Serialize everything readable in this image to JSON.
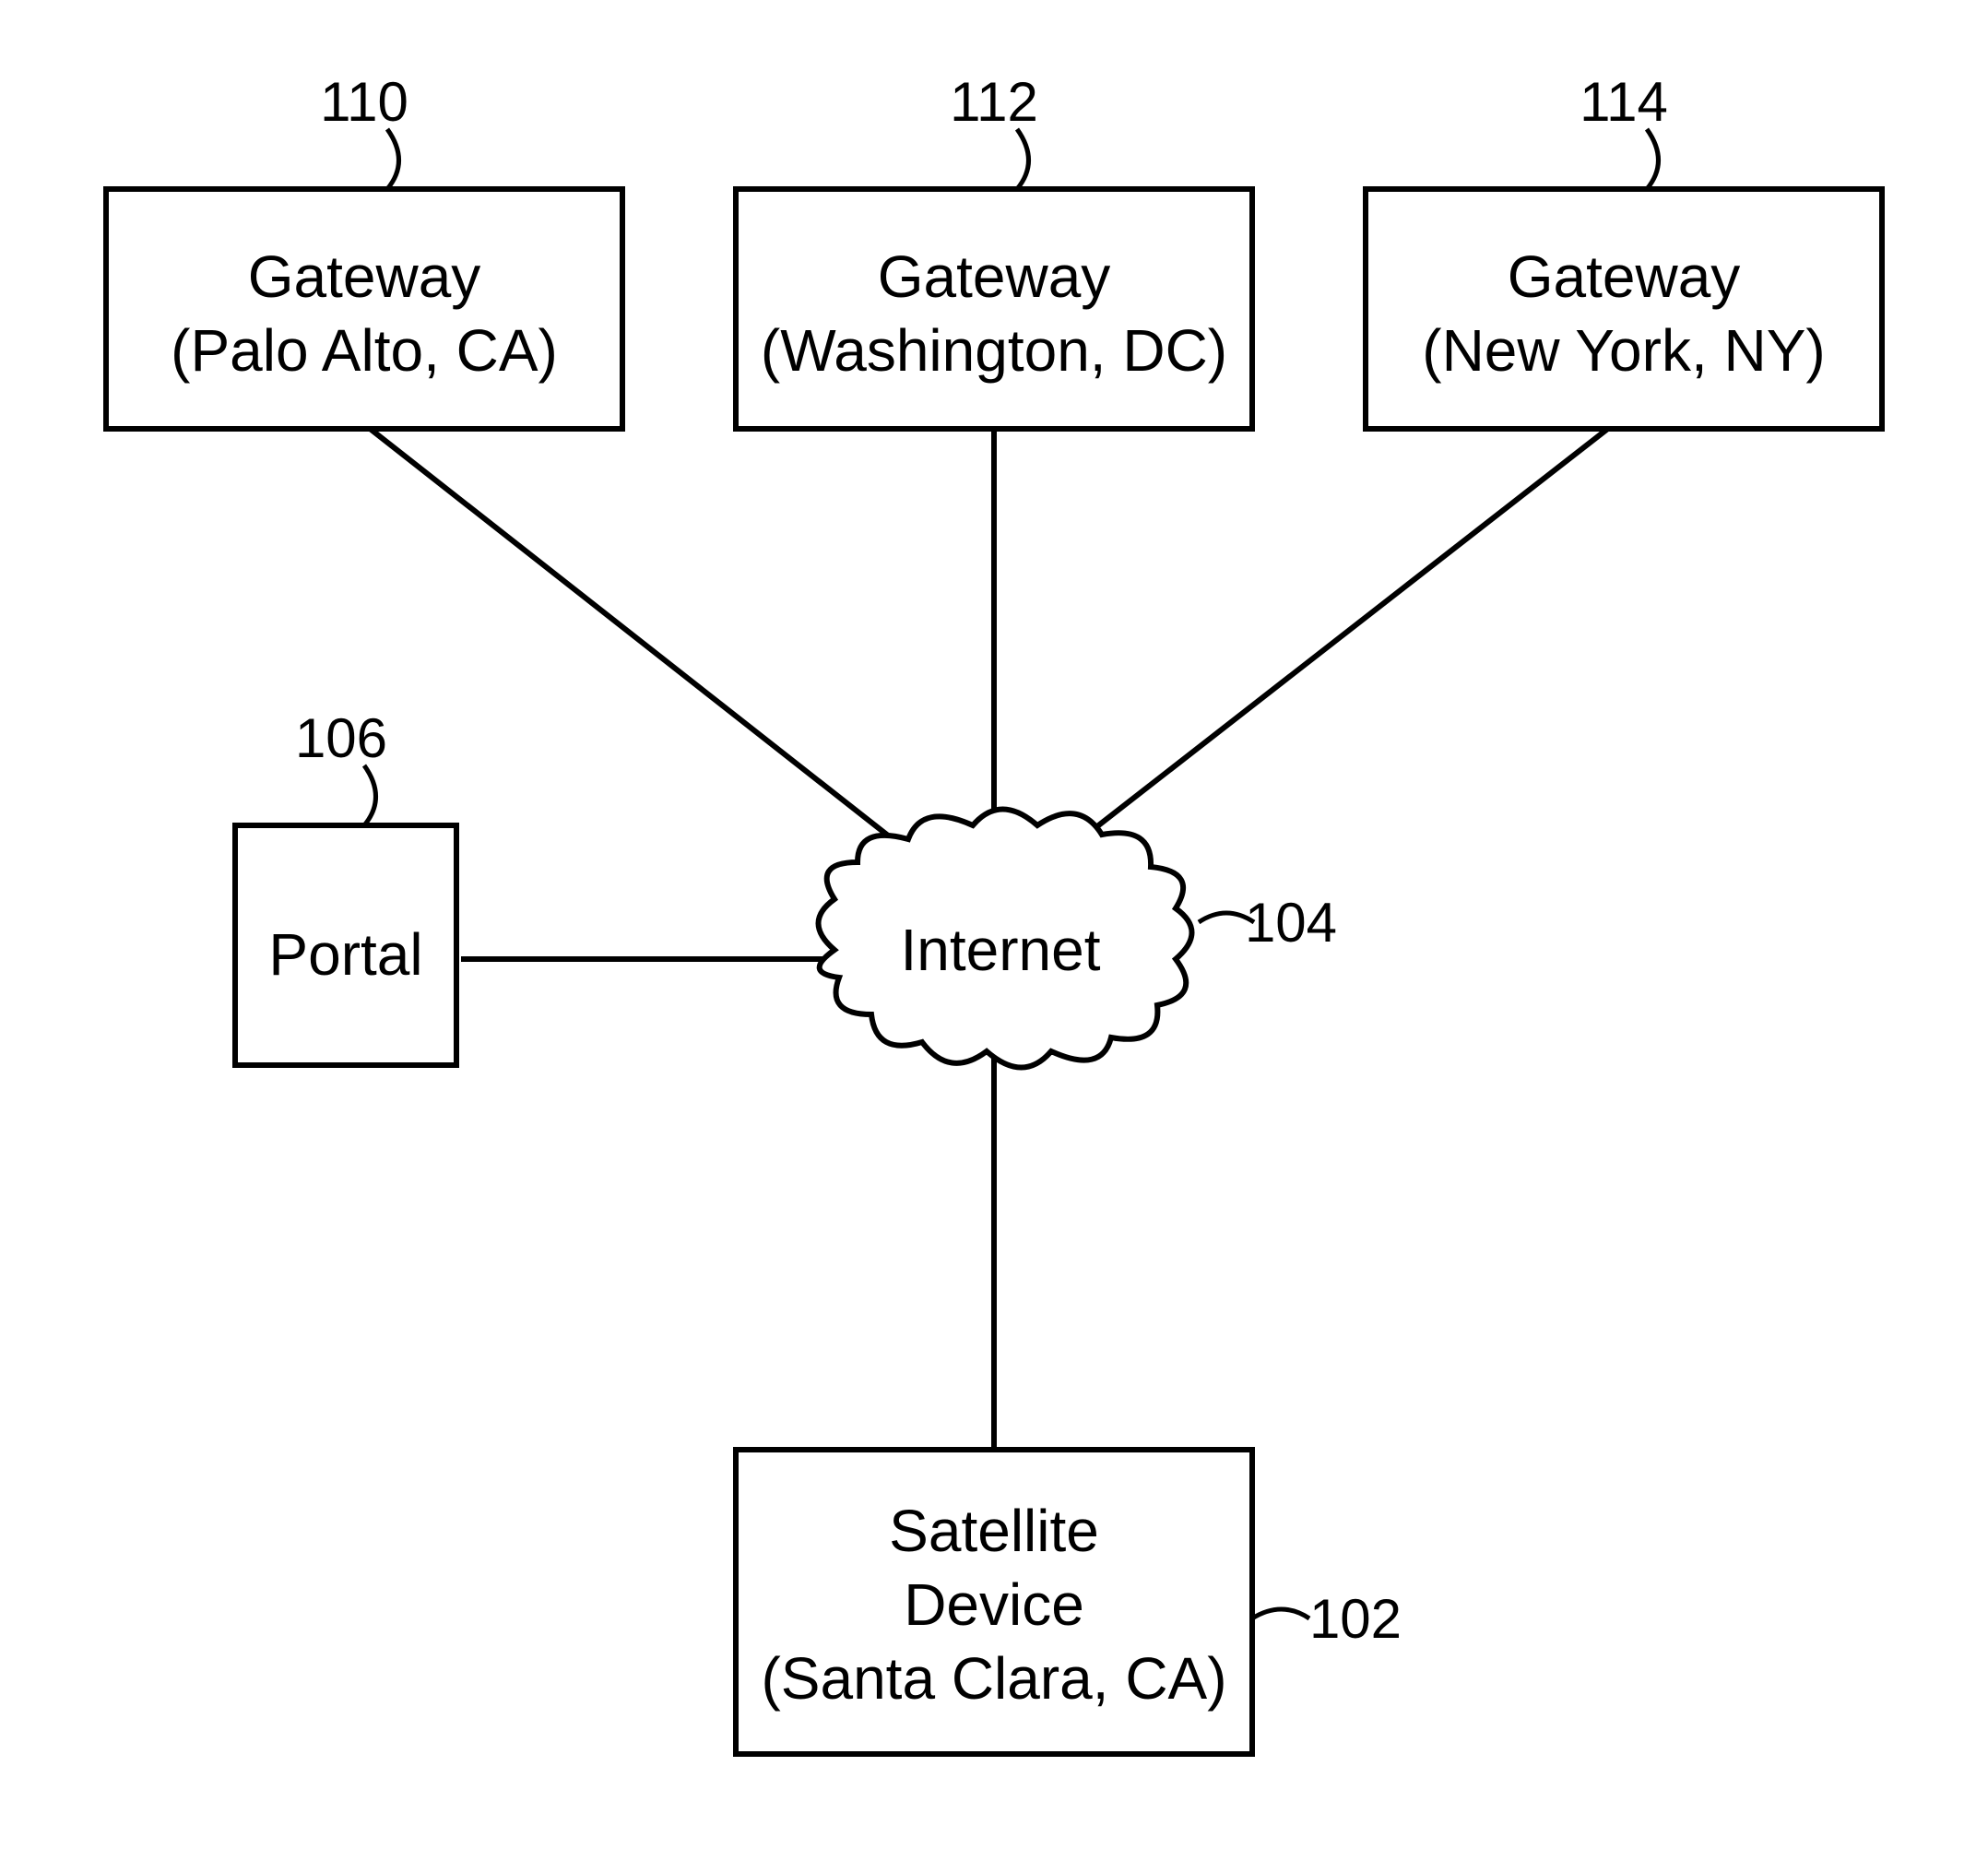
{
  "nodes": {
    "gateway1": {
      "ref": "110",
      "line1": "Gateway",
      "line2": "(Palo Alto, CA)"
    },
    "gateway2": {
      "ref": "112",
      "line1": "Gateway",
      "line2": "(Washington, DC)"
    },
    "gateway3": {
      "ref": "114",
      "line1": "Gateway",
      "line2": "(New York, NY)"
    },
    "portal": {
      "ref": "106",
      "label": "Portal"
    },
    "internet": {
      "ref": "104",
      "label": "Internet"
    },
    "satellite": {
      "ref": "102",
      "line1": "Satellite",
      "line2": "Device",
      "line3": "(Santa Clara, CA)"
    }
  }
}
